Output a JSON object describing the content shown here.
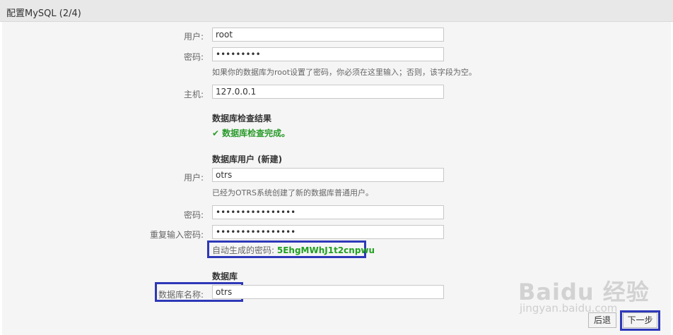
{
  "header": {
    "title": "配置MySQL (2/4)"
  },
  "form": {
    "user_label": "用户:",
    "user_value": "root",
    "password_label": "密码:",
    "password_value": "•••••••••",
    "password_hint": "如果你的数据库为root设置了密码，你必须在这里输入；否则，该字段为空。",
    "host_label": "主机:",
    "host_value": "127.0.0.1",
    "check_title": "数据库检查结果",
    "check_result": "数据库检查完成。",
    "db_user_title": "数据库用户 (新建)",
    "db_user_label": "用户:",
    "db_user_value": "otrs",
    "db_user_hint": "已经为OTRS系统创建了新的数据库普通用户。",
    "db_password_label": "密码:",
    "db_password_value": "••••••••••••••••",
    "db_password_repeat_label": "重复输入密码:",
    "db_password_repeat_value": "••••••••••••••••",
    "generated_password_label": "自动生成的密码:",
    "generated_password_value": "5EhgMWhJ1t2cnpwu",
    "database_title": "数据库",
    "db_name_label": "数据库名称:",
    "db_name_value": "otrs"
  },
  "buttons": {
    "back": "后退",
    "next": "下一步"
  },
  "watermark": {
    "brand": "Baidu 经验",
    "url": "jingyan.baidu.com"
  },
  "colors": {
    "success": "#2a9b2a",
    "highlight": "#2e38b8"
  }
}
